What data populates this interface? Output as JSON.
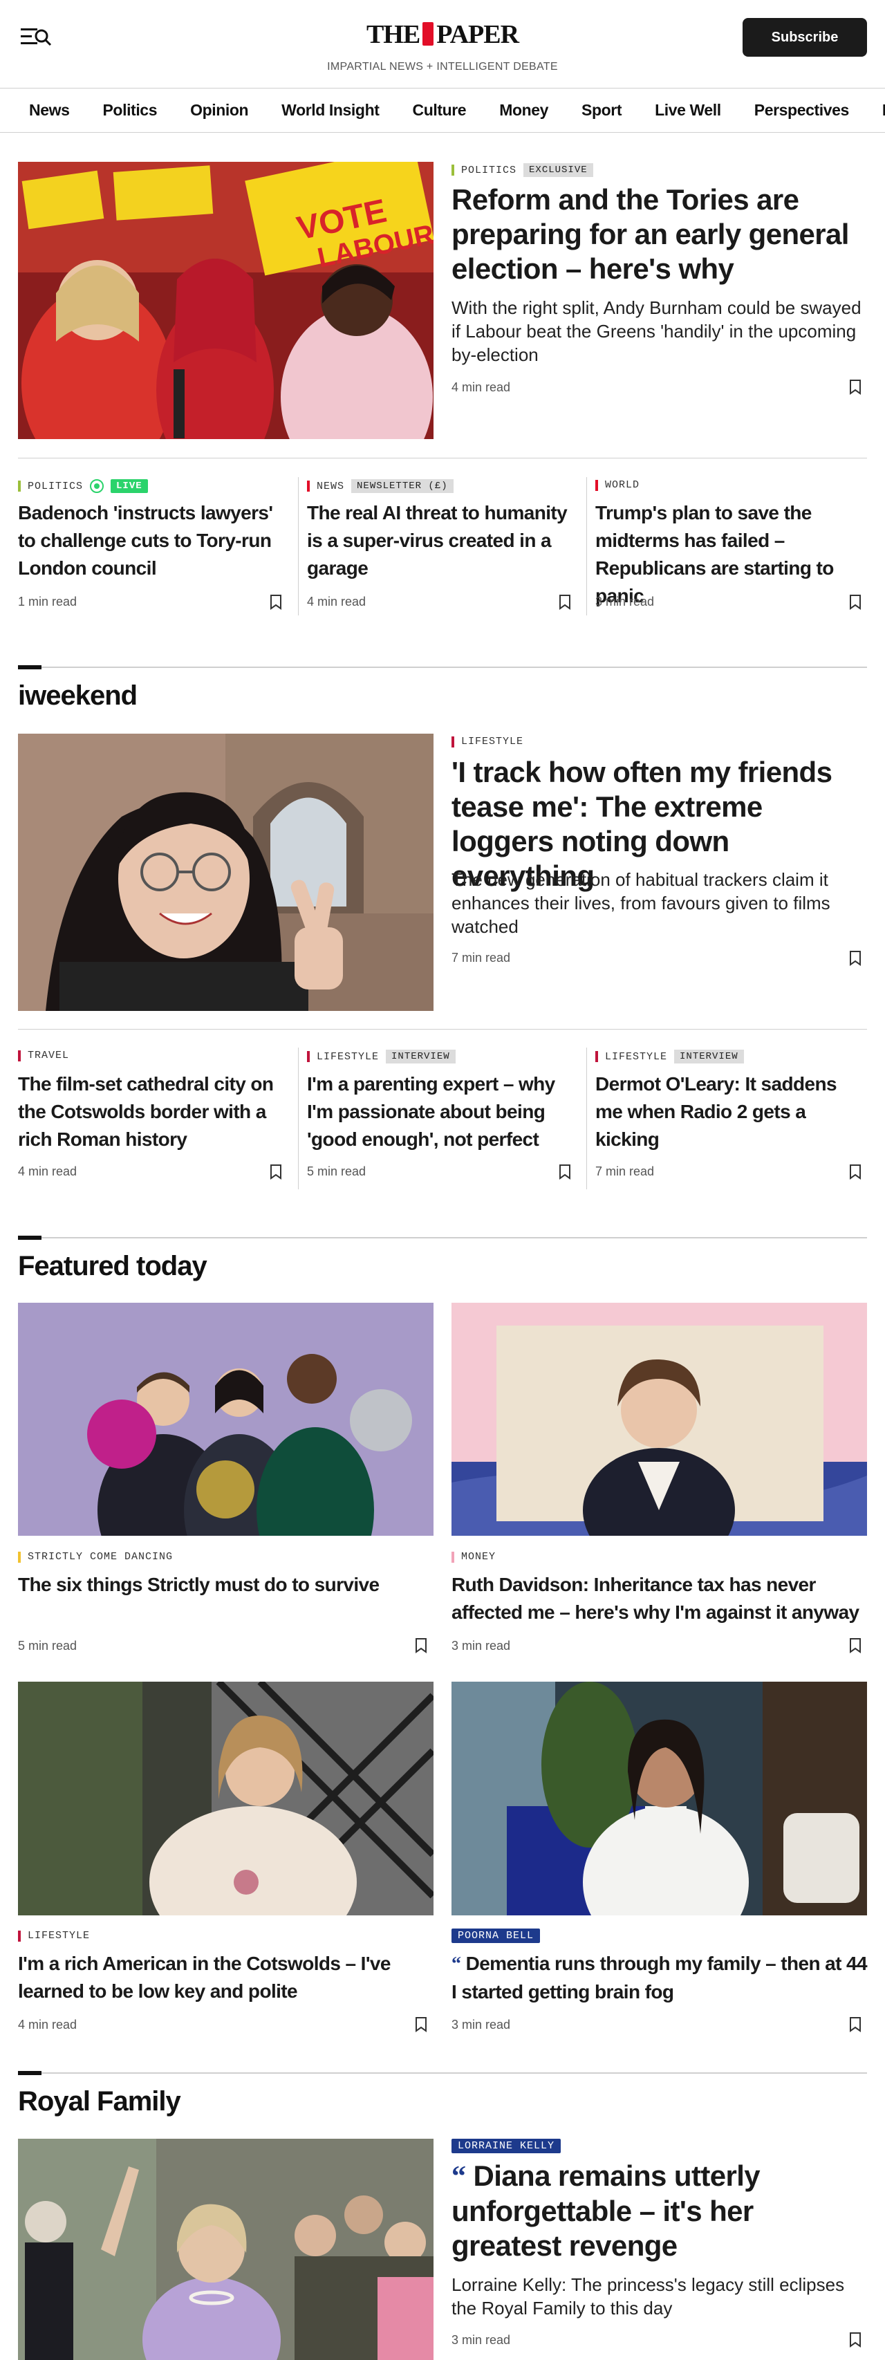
{
  "header": {
    "logo_left": "THE",
    "logo_right": "PAPER",
    "tagline": "IMPARTIAL NEWS + INTELLIGENT DEBATE",
    "subscribe_label": "Subscribe"
  },
  "nav": [
    "News",
    "Politics",
    "Opinion",
    "World Insight",
    "Culture",
    "Money",
    "Sport",
    "Live Well",
    "Perspectives",
    "Puzzles"
  ],
  "lead": {
    "tag": "POLITICS",
    "tag_color": "#9bbf3b",
    "badge": "EXCLUSIVE",
    "headline": "Reform and the Tories are preparing for an early general election – here's why",
    "standfirst": "With the right split, Andy Burnham could be swayed if Labour beat the Greens 'handily' in the upcoming by-election",
    "read_time": "4 min read"
  },
  "secondary": [
    {
      "tag": "POLITICS",
      "tag_color": "#9bbf3b",
      "live": "LIVE",
      "headline": "Badenoch 'instructs lawyers' to challenge cuts to Tory-run London council",
      "read_time": "1 min read"
    },
    {
      "tag": "NEWS",
      "tag_color": "#e20e28",
      "badge": "NEWSLETTER (£)",
      "headline": "The real AI threat to humanity is a super-virus created in a garage",
      "read_time": "4 min read"
    },
    {
      "tag": "WORLD",
      "tag_color": "#e20e28",
      "headline": "Trump's plan to save the midterms has failed – Republicans are starting to panic",
      "read_time": "3 min read"
    }
  ],
  "iweekend": {
    "title": "iweekend",
    "lead": {
      "tag": "LIFESTYLE",
      "tag_color": "#c0143c",
      "headline": "'I track how often my friends tease me': The extreme loggers noting down everything",
      "standfirst": "The new generation of habitual trackers claim it enhances their lives, from favours given to films watched",
      "read_time": "7 min read"
    },
    "items": [
      {
        "tag": "TRAVEL",
        "tag_color": "#c0143c",
        "headline": "The film-set cathedral city on the Cotswolds border with a rich Roman history",
        "read_time": "4 min read"
      },
      {
        "tag": "LIFESTYLE",
        "tag_color": "#c0143c",
        "badge": "INTERVIEW",
        "headline": "I'm a parenting expert – why I'm passionate about being 'good enough', not perfect",
        "read_time": "5 min read"
      },
      {
        "tag": "LIFESTYLE",
        "tag_color": "#c0143c",
        "badge": "INTERVIEW",
        "headline": "Dermot O'Leary: It saddens me when Radio 2 gets a kicking",
        "read_time": "7 min read"
      }
    ]
  },
  "featured": {
    "title": "Featured today",
    "items": [
      {
        "tag": "STRICTLY COME DANCING",
        "tag_color": "#f2c230",
        "headline": "The six things Strictly must do to survive",
        "read_time": "5 min read"
      },
      {
        "tag": "MONEY",
        "tag_color": "#f2a3b8",
        "headline": "Ruth Davidson: Inheritance tax has never affected me – here's why I'm against it anyway",
        "read_time": "3 min read"
      },
      {
        "tag": "LIFESTYLE",
        "tag_color": "#c0143c",
        "headline": "I'm a rich American in the Cotswolds – I've learned to be low key and polite",
        "read_time": "4 min read"
      },
      {
        "author": "POORNA BELL",
        "quote": "“",
        "headline": "Dementia runs through my family – then at 44 I started getting brain fog",
        "read_time": "3 min read"
      }
    ]
  },
  "royal": {
    "title": "Royal Family",
    "lead": {
      "author": "LORRAINE KELLY",
      "quote": "“",
      "headline": "Diana remains utterly unforgettable – it's her greatest revenge",
      "standfirst": "Lorraine Kelly: The princess's legacy still eclipses the Royal Family to this day",
      "read_time": "3 min read"
    }
  }
}
